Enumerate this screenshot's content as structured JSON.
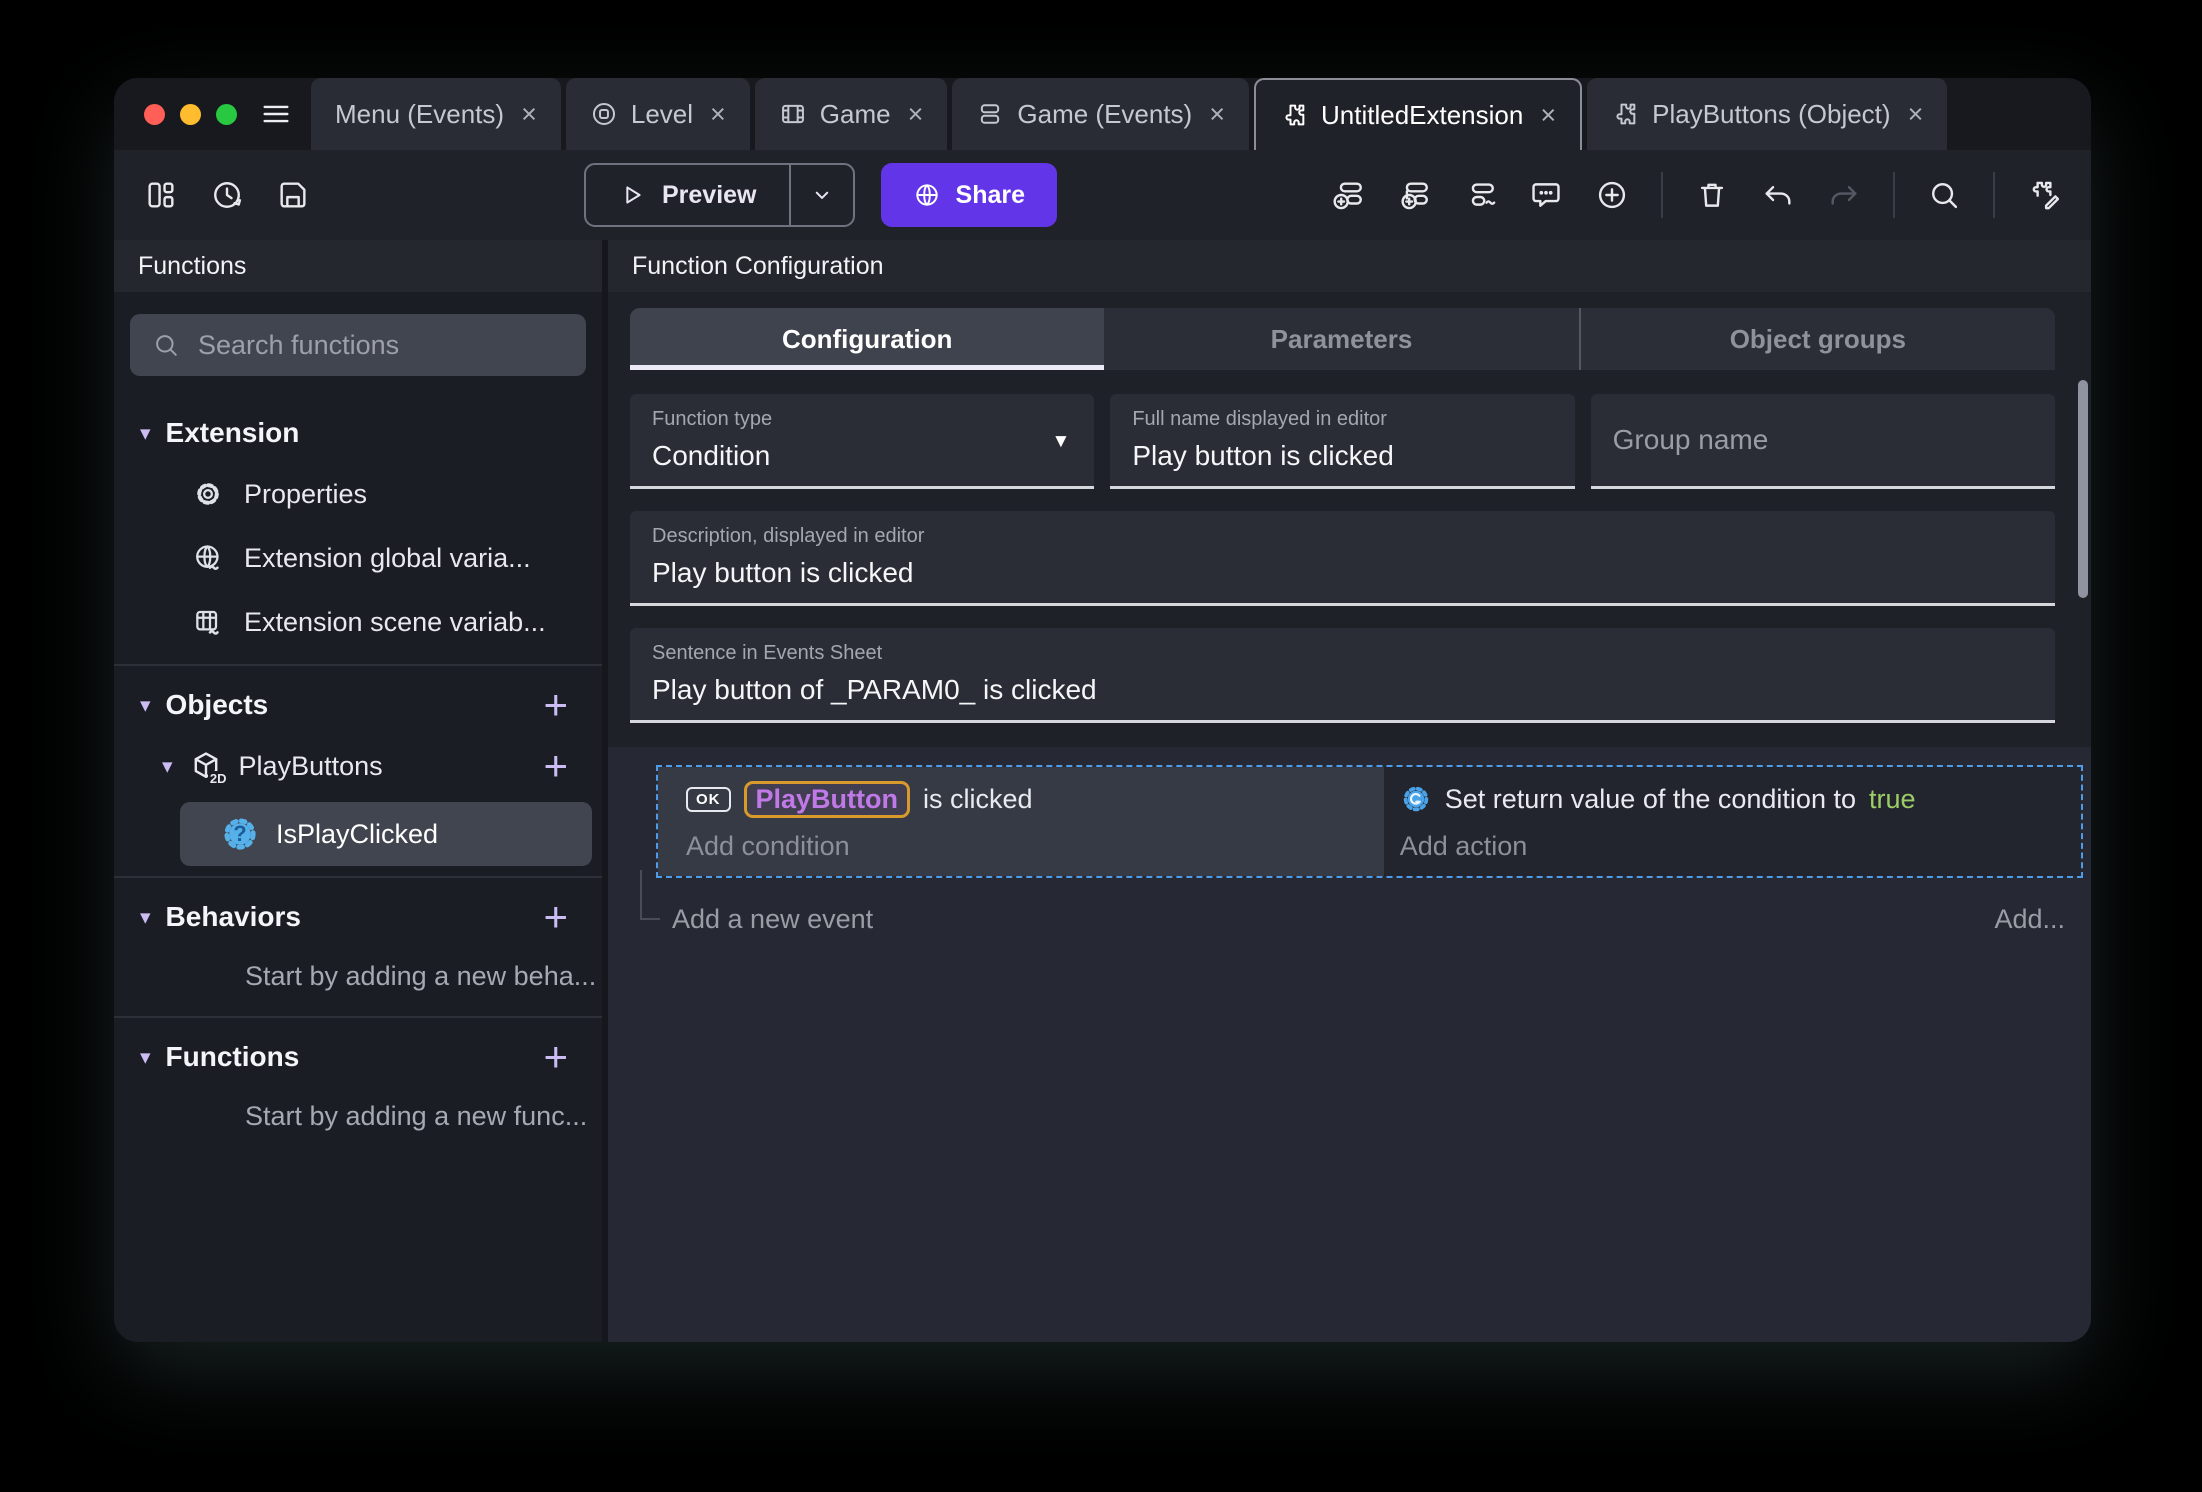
{
  "colors": {
    "accent_purple": "#6236e8",
    "selection_blue": "#4e9ce8",
    "chip_border_orange": "#d89b2b",
    "chip_text_purple": "#c279e8",
    "true_green": "#9ccc65"
  },
  "tabbar": {
    "close_glyph": "×",
    "tabs": [
      {
        "label": "Menu (Events)"
      },
      {
        "label": "Level"
      },
      {
        "label": "Game"
      },
      {
        "label": "Game (Events)"
      },
      {
        "label": "UntitledExtension"
      },
      {
        "label": "PlayButtons (Object)"
      }
    ]
  },
  "toolbar": {
    "preview_label": "Preview",
    "share_label": "Share"
  },
  "glyphs": {
    "chevron_down": "▾",
    "dropdown": "▼",
    "plus": "+",
    "question": "?"
  },
  "sidebar": {
    "title": "Functions",
    "search_placeholder": "Search functions",
    "extension_section": {
      "label": "Extension",
      "items": [
        {
          "label": "Properties"
        },
        {
          "label": "Extension global varia..."
        },
        {
          "label": "Extension scene variab..."
        }
      ]
    },
    "objects_section": {
      "label": "Objects",
      "object": {
        "label": "PlayButtons",
        "badge": "2D"
      },
      "function": {
        "label": "IsPlayClicked"
      }
    },
    "behaviors_section": {
      "label": "Behaviors",
      "empty_text": "Start by adding a new beha..."
    },
    "functions_section": {
      "label": "Functions",
      "empty_text": "Start by adding a new func..."
    }
  },
  "main": {
    "title": "Function Configuration",
    "tabs": [
      {
        "label": "Configuration"
      },
      {
        "label": "Parameters"
      },
      {
        "label": "Object groups"
      }
    ],
    "fields": {
      "function_type": {
        "label": "Function type",
        "value": "Condition"
      },
      "full_name": {
        "label": "Full name displayed in editor",
        "value": "Play button is clicked"
      },
      "group_name": {
        "placeholder": "Group name"
      },
      "description": {
        "label": "Description, displayed in editor",
        "value": "Play button is clicked"
      },
      "sentence": {
        "label": "Sentence in Events Sheet",
        "value": "Play button of _PARAM0_ is clicked"
      }
    },
    "events": {
      "condition": {
        "badge": "OK",
        "object_name": "PlayButton",
        "suffix": " is clicked",
        "add_label": "Add condition"
      },
      "action": {
        "prefix": "Set return value of the condition to ",
        "value": "true",
        "add_label": "Add action"
      },
      "add_new_event_label": "Add a new event",
      "add_more_label": "Add..."
    }
  }
}
